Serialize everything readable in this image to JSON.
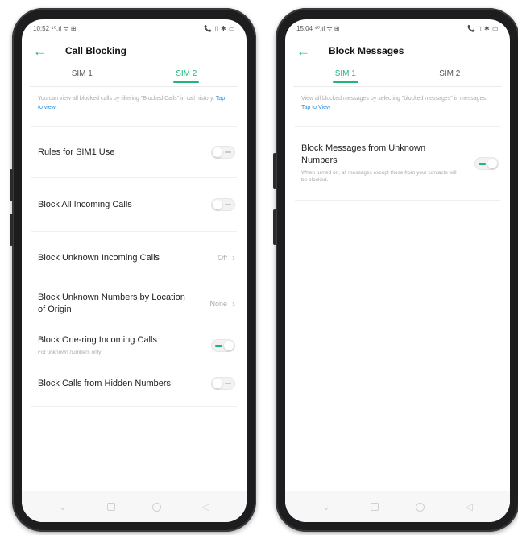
{
  "left_screen": {
    "status": {
      "time": "10:52",
      "left_icons": "⁴⁰.ıl ᯤ ⊞",
      "right_icons": "📞 ▯ ✱ ▭"
    },
    "title": "Call Blocking",
    "tabs": [
      {
        "label": "SIM 1",
        "active": false
      },
      {
        "label": "SIM 2",
        "active": true
      }
    ],
    "info_text": "You can view all blocked calls by filtering \"Blocked Calls\" in call history.",
    "info_link": "Tap to view",
    "rows": [
      {
        "label": "Rules for SIM1 Use",
        "control": "toggle",
        "state": "off"
      },
      {
        "label": "Block All Incoming Calls",
        "control": "toggle",
        "state": "off"
      },
      {
        "label": "Block Unknown Incoming Calls",
        "control": "value",
        "value": "Off"
      },
      {
        "label": "Block Unknown Numbers by Location of Origin",
        "control": "value",
        "value": "None"
      },
      {
        "label": "Block One-ring Incoming Calls",
        "sub": "For unknown numbers only",
        "control": "toggle",
        "state": "on"
      },
      {
        "label": "Block Calls from Hidden Numbers",
        "control": "toggle",
        "state": "off"
      }
    ]
  },
  "right_screen": {
    "status": {
      "time": "15:04",
      "left_icons": "⁴⁰.ıl ᯤ ⊞",
      "right_icons": "📞 ▯ ✱ ▭"
    },
    "title": "Block Messages",
    "tabs": [
      {
        "label": "SIM 1",
        "active": true
      },
      {
        "label": "SIM 2",
        "active": false
      }
    ],
    "info_text": "View all blocked messages by selecting \"blocked messages\" in messages.",
    "info_link": "Tap to View",
    "rows": [
      {
        "label": "Block Messages from Unknown Numbers",
        "sub": "When turned on, all messages except those from your contacts will be blocked.",
        "control": "toggle",
        "state": "on"
      }
    ]
  },
  "colors": {
    "accent": "#20b57a",
    "link": "#2b8cdc",
    "frame": "#1d1d1f"
  },
  "icons": {
    "back": "back-arrow-icon",
    "chevron": "chevron-right-icon"
  }
}
